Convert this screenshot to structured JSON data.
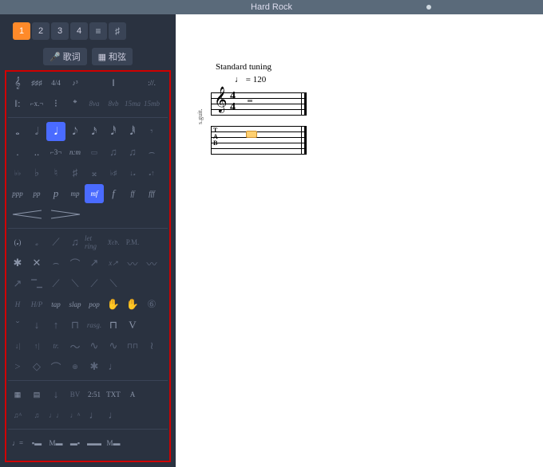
{
  "title": "Hard Rock",
  "tabs": [
    "1",
    "2",
    "3",
    "4"
  ],
  "active_tab": 0,
  "tabicons": [
    "≡",
    "♯"
  ],
  "buttons": {
    "lyrics": "歌词",
    "chords": "和弦"
  },
  "score": {
    "tuning": "Standard tuning",
    "tempo_note": "♩",
    "tempo_eq": "= 120",
    "instrument": "s.guit.",
    "timesig_num": "4",
    "timesig_den": "4",
    "tab_label": "T\nA\nB"
  },
  "palette": {
    "rows": [
      [
        {
          "t": "𝄞",
          "n": "treble-clef-icon"
        },
        {
          "t": "♯♯♯",
          "n": "key-signature-icon",
          "sm": true
        },
        {
          "t": "4/4",
          "n": "time-signature-icon",
          "sm": true
        },
        {
          "t": "♪³",
          "n": "triplet-feel-icon",
          "sm": true
        },
        {
          "t": "",
          "n": "blank"
        },
        {
          "t": "‖",
          "n": "double-barline-icon"
        },
        {
          "t": "",
          "n": "blank"
        },
        {
          "t": "://.",
          "n": "repeat-sign-icon",
          "sm": true
        }
      ],
      [
        {
          "t": "‖:",
          "n": "repeat-start-icon"
        },
        {
          "t": "⌐x.¬",
          "n": "repeat-alt-icon",
          "sm": true
        },
        {
          "t": "⁝",
          "n": "barline-dashed-icon"
        },
        {
          "t": "𝄌",
          "n": "coda-icon"
        },
        {
          "t": "8va",
          "n": "octave-up-icon",
          "italic": true,
          "sm": true,
          "dim": true
        },
        {
          "t": "8vb",
          "n": "octave-down-icon",
          "italic": true,
          "sm": true,
          "dim": true
        },
        {
          "t": "15ma",
          "n": "two-octave-up-icon",
          "italic": true,
          "sm": true,
          "dim": true
        },
        {
          "t": "15mb",
          "n": "two-octave-down-icon",
          "italic": true,
          "sm": true,
          "dim": true
        }
      ],
      "divider",
      [
        {
          "t": "𝅝",
          "n": "whole-note-icon"
        },
        {
          "t": "𝅗𝅥",
          "n": "half-note-icon"
        },
        {
          "t": "𝅘𝅥",
          "n": "quarter-note-icon",
          "sel": true
        },
        {
          "t": "𝅘𝅥𝅮",
          "n": "eighth-note-icon"
        },
        {
          "t": "𝅘𝅥𝅯",
          "n": "sixteenth-note-icon"
        },
        {
          "t": "𝅘𝅥𝅰",
          "n": "thirtysecond-note-icon"
        },
        {
          "t": "𝅘𝅥𝅱",
          "n": "sixtyfourth-note-icon"
        },
        {
          "t": "𝄾",
          "n": "rest-icon",
          "dim": true
        }
      ],
      [
        {
          "t": ".",
          "n": "dotted-icon"
        },
        {
          "t": "..",
          "n": "double-dotted-icon"
        },
        {
          "t": "⌐3¬",
          "n": "tuplet-3-icon",
          "sm": true
        },
        {
          "t": "n:m",
          "n": "tuplet-nm-icon",
          "italic": true,
          "sm": true
        },
        {
          "t": "▭",
          "n": "multirest-icon",
          "sm": true,
          "dim": true
        },
        {
          "t": "♫",
          "n": "beam-icon",
          "dim": true
        },
        {
          "t": "♫",
          "n": "beam-alt-icon",
          "dim": true
        },
        {
          "t": "⌢",
          "n": "tie-icon",
          "dim": true
        }
      ],
      [
        {
          "t": "♭♭",
          "n": "double-flat-icon",
          "sm": true,
          "dim": true
        },
        {
          "t": "♭",
          "n": "flat-icon",
          "dim": true
        },
        {
          "t": "♮",
          "n": "natural-icon",
          "dim": true
        },
        {
          "t": "♯",
          "n": "sharp-icon",
          "dim": true
        },
        {
          "t": "𝄪",
          "n": "double-sharp-icon",
          "dim": true
        },
        {
          "t": "♭♯",
          "n": "accidental-combo-icon",
          "sm": true,
          "dim": true
        },
        {
          "t": "↓𝅘",
          "n": "shift-down-icon",
          "sm": true,
          "dim": true
        },
        {
          "t": "𝅘↑",
          "n": "shift-up-icon",
          "sm": true,
          "dim": true
        }
      ],
      [
        {
          "t": "ppp",
          "n": "dynamic-ppp-icon",
          "italic": true,
          "sm": true
        },
        {
          "t": "pp",
          "n": "dynamic-pp-icon",
          "italic": true,
          "sm": true
        },
        {
          "t": "p",
          "n": "dynamic-p-icon",
          "italic": true
        },
        {
          "t": "mp",
          "n": "dynamic-mp-icon",
          "italic": true,
          "sm": true
        },
        {
          "t": "mf",
          "n": "dynamic-mf-icon",
          "italic": true,
          "sm": true,
          "sel": true
        },
        {
          "t": "f",
          "n": "dynamic-f-icon",
          "italic": true
        },
        {
          "t": "ff",
          "n": "dynamic-ff-icon",
          "italic": true,
          "sm": true
        },
        {
          "t": "fff",
          "n": "dynamic-fff-icon",
          "italic": true,
          "sm": true
        }
      ],
      [
        {
          "t": "",
          "n": "crescendo-icon",
          "cls": "crescendo",
          "svg": "cresc"
        },
        {
          "t": "",
          "n": "decrescendo-icon",
          "cls": "crescendo",
          "svg": "decresc"
        }
      ],
      "divider",
      [
        {
          "t": "(𝅘)",
          "n": "ghost-note-icon",
          "sm": true
        },
        {
          "t": "𝅗",
          "n": "dead-note-icon",
          "dim": true
        },
        {
          "t": "⟋",
          "n": "slide-icon",
          "dim": true
        },
        {
          "t": "♫",
          "n": "grace-note-icon",
          "dim": true
        },
        {
          "t": "let ring",
          "n": "let-ring-icon",
          "italic": true,
          "sm": true,
          "dim": true
        },
        {
          "t": "𝔛𝔢𝔡.",
          "n": "pedal-icon",
          "sm": true,
          "dim": true
        },
        {
          "t": "P.M.",
          "n": "palm-mute-icon",
          "sm": true,
          "dim": true
        }
      ],
      [
        {
          "t": "✱",
          "n": "natural-harmonic-icon"
        },
        {
          "t": "✕",
          "n": "artificial-harmonic-icon"
        },
        {
          "t": "⌢",
          "n": "hammer-icon",
          "dim": true
        },
        {
          "t": "⌒",
          "n": "pull-off-icon",
          "dim": true
        },
        {
          "t": "↗",
          "n": "bend-icon",
          "dim": true
        },
        {
          "t": "x↗",
          "n": "bend-release-icon",
          "italic": true,
          "sm": true,
          "dim": true
        },
        {
          "t": "〰",
          "n": "vibrato-icon",
          "dim": true
        },
        {
          "t": "〰",
          "n": "wide-vibrato-icon",
          "dim": true
        }
      ],
      [
        {
          "t": "↗",
          "n": "slide-in-below-icon",
          "dim": true
        },
        {
          "t": "▔▁",
          "n": "slide-shift-icon",
          "sm": true,
          "dim": true
        },
        {
          "t": "⟋",
          "n": "slide-out-icon",
          "dim": true
        },
        {
          "t": "⟍",
          "n": "slide-legato-icon",
          "dim": true
        },
        {
          "t": "⟋",
          "n": "slide-in-above-icon",
          "dim": true
        },
        {
          "t": "⟍",
          "n": "slide-out-down-icon",
          "dim": true
        },
        {
          "t": "",
          "n": "blank"
        },
        {
          "t": "",
          "n": "blank"
        }
      ],
      [
        {
          "t": "H",
          "n": "left-hand-tap-icon",
          "italic": true,
          "sm": true,
          "dim": true
        },
        {
          "t": "H/P",
          "n": "hopo-icon",
          "italic": true,
          "sm": true,
          "dim": true
        },
        {
          "t": "tap",
          "n": "tap-icon",
          "italic": true,
          "sm": true
        },
        {
          "t": "slap",
          "n": "slap-icon",
          "italic": true,
          "sm": true
        },
        {
          "t": "pop",
          "n": "pop-icon",
          "italic": true,
          "sm": true
        },
        {
          "t": "✋",
          "n": "hand-icon"
        },
        {
          "t": "✋",
          "n": "hand-alt-icon",
          "dim": true
        },
        {
          "t": "⑥",
          "n": "string-6-icon",
          "dim": true
        }
      ],
      [
        {
          "t": "ˇ",
          "n": "accent-icon",
          "dim": true
        },
        {
          "t": "↓",
          "n": "strum-down-icon",
          "dim": true
        },
        {
          "t": "↑",
          "n": "strum-up-icon",
          "dim": true
        },
        {
          "t": "⊓",
          "n": "downstroke-icon",
          "dim": true
        },
        {
          "t": "rasg.",
          "n": "rasgueado-icon",
          "italic": true,
          "sm": true,
          "dim": true
        },
        {
          "t": "⊓",
          "n": "pickstroke-down-icon"
        },
        {
          "t": "V",
          "n": "pickstroke-up-icon"
        }
      ],
      [
        {
          "t": "↓|",
          "n": "arpeggio-down-icon",
          "sm": true,
          "dim": true
        },
        {
          "t": "↑|",
          "n": "arpeggio-up-icon",
          "sm": true,
          "dim": true
        },
        {
          "t": "tr.",
          "n": "trill-icon",
          "italic": true,
          "sm": true,
          "dim": true
        },
        {
          "t": "〜",
          "n": "ornament-turn-icon",
          "dim": true
        },
        {
          "t": "∿",
          "n": "ornament-mordent-icon",
          "dim": true
        },
        {
          "t": "∿",
          "n": "ornament-inv-mordent-icon",
          "dim": true
        },
        {
          "t": "⊓⊓",
          "n": "tremolo-picking-icon",
          "sm": true,
          "dim": true
        },
        {
          "t": "≀",
          "n": "wah-icon",
          "dim": true
        }
      ],
      [
        {
          "t": ">",
          "n": "accent-mark-icon",
          "dim": true
        },
        {
          "t": "◇",
          "n": "fermata-short-icon",
          "dim": true
        },
        {
          "t": "⌒",
          "n": "fermata-icon",
          "dim": true
        },
        {
          "t": "⊕",
          "n": "harmonic-touch-icon",
          "sm": true,
          "dim": true
        },
        {
          "t": "✱",
          "n": "staccatissimo-icon",
          "dim": true
        },
        {
          "t": "♩",
          "n": "tenuto-icon",
          "dim": true
        }
      ],
      "divider",
      [
        {
          "t": "▦",
          "n": "chord-diagram-icon",
          "sm": true
        },
        {
          "t": "▤",
          "n": "fretboard-icon",
          "sm": true
        },
        {
          "t": "↓",
          "n": "barre-icon",
          "dim": true
        },
        {
          "t": "BV",
          "n": "barre-roman-icon",
          "sm": true,
          "dim": true
        },
        {
          "t": "2:51",
          "n": "timer-icon",
          "sm": true
        },
        {
          "t": "TXT",
          "n": "text-icon",
          "sm": true
        },
        {
          "t": "A",
          "n": "section-icon",
          "sm": true
        }
      ],
      [
        {
          "t": "♫ᴬ",
          "n": "auto-beam-icon",
          "sm": true,
          "dim": true
        },
        {
          "t": "♫",
          "n": "beam-group-icon",
          "sm": true,
          "dim": true
        },
        {
          "t": "♩♩",
          "n": "stem-dir-icon",
          "sm": true,
          "dim": true
        },
        {
          "t": "♩ᴬ",
          "n": "auto-stem-icon",
          "sm": true,
          "dim": true
        },
        {
          "t": "♩",
          "n": "voice-icon",
          "dim": true
        },
        {
          "t": "♩",
          "n": "voice-2-icon",
          "dim": true
        }
      ],
      "divider",
      [
        {
          "t": "♩=",
          "n": "tempo-change-icon",
          "sm": true
        },
        {
          "t": "▪▬",
          "n": "bar-graph-1-icon",
          "sm": true
        },
        {
          "t": "M▬",
          "n": "bar-graph-m-icon",
          "sm": true
        },
        {
          "t": "▬▪",
          "n": "bar-graph-2-icon",
          "sm": true
        },
        {
          "t": "▬▬",
          "n": "bar-graph-3-icon",
          "sm": true
        },
        {
          "t": "M▬",
          "n": "bar-graph-m2-icon",
          "sm": true
        }
      ]
    ]
  }
}
